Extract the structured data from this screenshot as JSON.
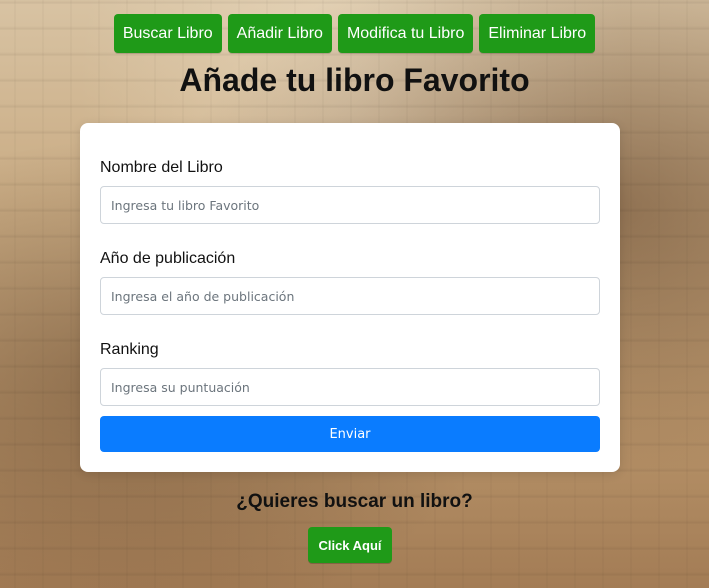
{
  "nav": {
    "items": [
      {
        "label": "Buscar Libro"
      },
      {
        "label": "Añadir Libro"
      },
      {
        "label": "Modifica tu Libro"
      },
      {
        "label": "Eliminar Libro"
      }
    ]
  },
  "page": {
    "title": "Añade tu libro Favorito"
  },
  "form": {
    "fields": [
      {
        "label": "Nombre del Libro",
        "value": "",
        "placeholder": "Ingresa tu libro Favorito"
      },
      {
        "label": "Año de publicación",
        "value": "",
        "placeholder": "Ingresa el año de publicación"
      },
      {
        "label": "Ranking",
        "value": "",
        "placeholder": "Ingresa su puntuación"
      }
    ],
    "submit_label": "Enviar"
  },
  "footer": {
    "question": "¿Quieres buscar un libro?",
    "cta_label": "Click Aquí"
  },
  "colors": {
    "nav_button_bg": "#1f9a18",
    "submit_button_bg": "#0a7cff",
    "card_bg": "#ffffff"
  }
}
